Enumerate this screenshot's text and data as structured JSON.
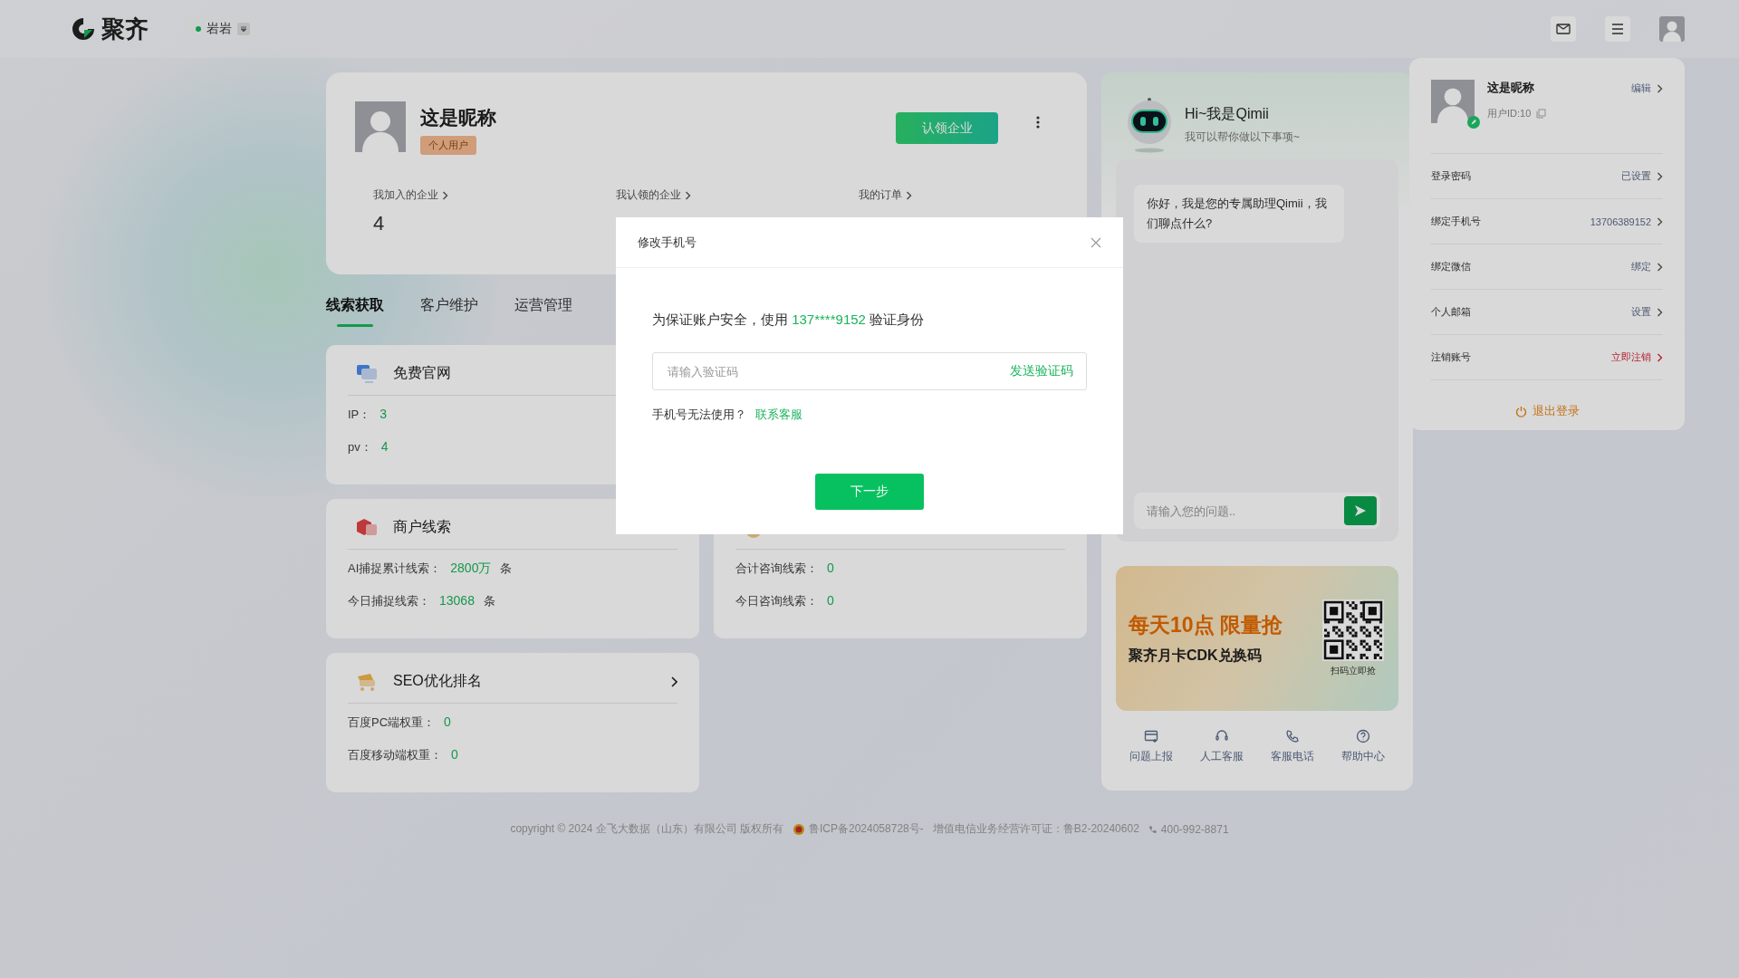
{
  "header": {
    "logo": "聚齐",
    "tenant": "岩岩"
  },
  "profile": {
    "nickname": "这是昵称",
    "badge": "个人用户",
    "claim_button": "认领企业",
    "stats": [
      {
        "label": "我加入的企业",
        "value": "4"
      },
      {
        "label": "我认领的企业"
      },
      {
        "label": "我的订单"
      }
    ]
  },
  "tabs": [
    {
      "label": "线索获取",
      "selected": true
    },
    {
      "label": "客户维护",
      "selected": false
    },
    {
      "label": "运营管理",
      "selected": false
    }
  ],
  "cards": [
    {
      "title": "免费官网",
      "rows": [
        {
          "label": "IP：",
          "value": "3"
        },
        {
          "label": "pv：",
          "value": "4"
        }
      ]
    },
    {
      "title": "商户线索",
      "rows": [
        {
          "label": "AI捕捉累计线索：",
          "value": "2800万",
          "unit": "条"
        },
        {
          "label": "今日捕捉线索：",
          "value": "13068",
          "unit": "条"
        }
      ]
    },
    {
      "rows": [
        {
          "label": "合计咨询线索：",
          "value": "0"
        },
        {
          "label": "今日咨询线索：",
          "value": "0"
        }
      ]
    },
    {
      "title": "SEO优化排名",
      "link": true,
      "rows": [
        {
          "label": "百度PC端权重：",
          "value": "0"
        },
        {
          "label": "百度移动端权重：",
          "value": "0"
        }
      ]
    }
  ],
  "chat": {
    "greeting": "Hi~我是Qimii",
    "subtitle": "我可以帮你做以下事项~",
    "messages": [
      "你好，我是您的专属助理Qimii，我们聊点什么?"
    ],
    "input_placeholder": "请输入您的问题..",
    "promo": {
      "headline": "每天10点 限量抢",
      "subline": "聚齐月卡CDK兑换码",
      "qr_caption": "扫码立即抢"
    },
    "shortcuts": [
      {
        "label": "问题上报"
      },
      {
        "label": "人工客服"
      },
      {
        "label": "客服电话"
      },
      {
        "label": "帮助中心"
      }
    ]
  },
  "account_menu": {
    "nickname": "这是昵称",
    "user_id": "用户ID:10",
    "edit": "编辑",
    "rows": [
      {
        "label": "登录密码",
        "value": "已设置",
        "kind": "normal"
      },
      {
        "label": "绑定手机号",
        "value": "13706389152",
        "kind": "normal"
      },
      {
        "label": "绑定微信",
        "value": "绑定",
        "kind": "normal"
      },
      {
        "label": "个人邮箱",
        "value": "设置",
        "kind": "normal"
      },
      {
        "label": "注销账号",
        "value": "立即注销",
        "kind": "danger"
      }
    ],
    "logout": "退出登录"
  },
  "dialog": {
    "title": "修改手机号",
    "message_before": "为保证账户安全，使用",
    "phone": "137****9152",
    "message_after": "验证身份",
    "code_placeholder": "请输入验证码",
    "send_code": "发送验证码",
    "help_text": "手机号无法使用？",
    "help_link": "联系客服",
    "next_button": "下一步"
  },
  "footer": {
    "copyright": "copyright © 2024 企飞大数据（山东）有限公司 版权所有",
    "icp": "鲁ICP备2024058728号-",
    "license": "增值电信业务经营许可证：鲁B2-20240602",
    "phone": "400-992-8871"
  }
}
